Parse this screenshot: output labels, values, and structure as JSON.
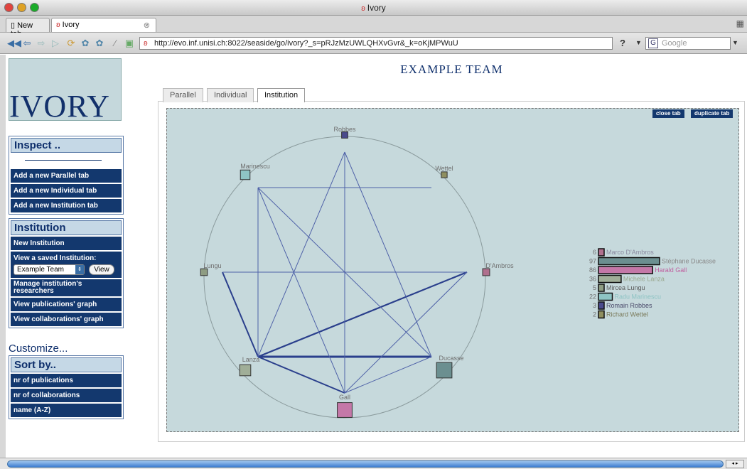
{
  "window": {
    "title": "Ivory"
  },
  "browser": {
    "tabs": [
      {
        "label": "New tab"
      },
      {
        "label": "Ivory"
      }
    ],
    "url": "http://evo.inf.unisi.ch:8022/seaside/go/ivory?_s=pRJzMzUWLQHXvGvr&_k=oKjMPWuU",
    "search_placeholder": "Google"
  },
  "app": {
    "logo": "IVORY",
    "title": "EXAMPLE TEAM",
    "inspect": {
      "heading": "Inspect ..",
      "items": [
        "Add a new Parallel tab",
        "Add a new Individual tab",
        "Add a new Institution tab"
      ]
    },
    "institution": {
      "heading": "Institution",
      "new": "New Institution",
      "view_saved_label": "View a saved Institution:",
      "selected": "Example Team",
      "view_button": "View",
      "manage": "Manage institution's researchers",
      "pubs_graph": "View publications' graph",
      "collab_graph": "View collaborations' graph"
    },
    "customize": "Customize...",
    "sort": {
      "heading": "Sort by..",
      "items": [
        "nr of publications",
        "nr of collaborations",
        "name (A-Z)"
      ]
    },
    "view_tabs": [
      "Parallel",
      "Individual",
      "Institution"
    ],
    "active_view_tab": "Institution",
    "close_tab": "close tab",
    "duplicate_tab": "duplicate tab"
  },
  "chart_data": {
    "type": "network",
    "nodes": [
      {
        "name": "Robbes",
        "publications": 3,
        "color": "#4a4a8c"
      },
      {
        "name": "Wettel",
        "publications": 2,
        "color": "#8f8f60"
      },
      {
        "name": "D'Ambros",
        "publications": 6,
        "color": "#b0708e"
      },
      {
        "name": "Ducasse",
        "publications": 97,
        "color": "#6b8f90"
      },
      {
        "name": "Gall",
        "publications": 86,
        "color": "#c478a8"
      },
      {
        "name": "Lanza",
        "publications": 36,
        "color": "#a0ae98"
      },
      {
        "name": "Lungu",
        "publications": 5,
        "color": "#8e9c82"
      },
      {
        "name": "Marinescu",
        "publications": 22,
        "color": "#8ec4c4"
      }
    ],
    "edges": [
      [
        "Lanza",
        "Ducasse"
      ],
      [
        "Lanza",
        "D'Ambros"
      ],
      [
        "Lanza",
        "Gall"
      ],
      [
        "Lanza",
        "Lungu"
      ],
      [
        "Lanza",
        "Robbes"
      ],
      [
        "Lanza",
        "Marinescu"
      ],
      [
        "Ducasse",
        "Gall"
      ],
      [
        "Ducasse",
        "Marinescu"
      ],
      [
        "Gall",
        "Robbes"
      ],
      [
        "Gall",
        "Marinescu"
      ],
      [
        "Ducasse",
        "Robbes"
      ],
      [
        "Marinescu",
        "Wettel"
      ],
      [
        "Lungu",
        "D'Ambros"
      ],
      [
        "Gall",
        "D'Ambros"
      ]
    ],
    "legend": [
      {
        "count": "6",
        "name": "Marco D'Ambros",
        "color": "#b0708e",
        "label_color": "#8a8aa0"
      },
      {
        "count": "97",
        "name": "Stéphane Ducasse",
        "color": "#6b8f90",
        "label_color": "#8a8a8a"
      },
      {
        "count": "86",
        "name": "Harald Gall",
        "color": "#c478a8",
        "label_color": "#c060a0"
      },
      {
        "count": "36",
        "name": "Michele Lanza",
        "color": "#a0ae98",
        "label_color": "#9aa890"
      },
      {
        "count": "5",
        "name": "Mircea Lungu",
        "color": "#8e9c82",
        "label_color": "#5a5a5a"
      },
      {
        "count": "22",
        "name": "Radu Marinescu",
        "color": "#8ec4c4",
        "label_color": "#8ec4c4"
      },
      {
        "count": "3",
        "name": "Romain Robbes",
        "color": "#4a4a8c",
        "label_color": "#4a4a6a"
      },
      {
        "count": "2",
        "name": "Richard Wettel",
        "color": "#8f8f60",
        "label_color": "#7a7a5a"
      }
    ]
  }
}
